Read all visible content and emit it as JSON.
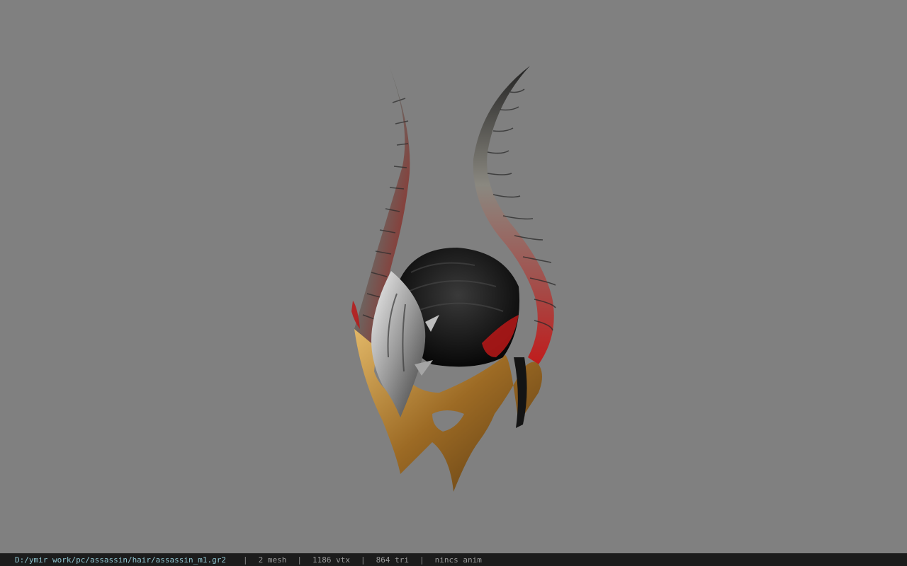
{
  "viewer": {
    "background_color": "#808080",
    "model_icon": "horned-helmet-model"
  },
  "statusbar": {
    "file_path": "D:/ymir work/pc/assassin/hair/assassin_m1.gr2",
    "separator": "|",
    "mesh_count": "2 mesh",
    "vertex_count": "1186 vtx",
    "triangle_count": "864 tri",
    "anim_status": "nincs anim"
  }
}
